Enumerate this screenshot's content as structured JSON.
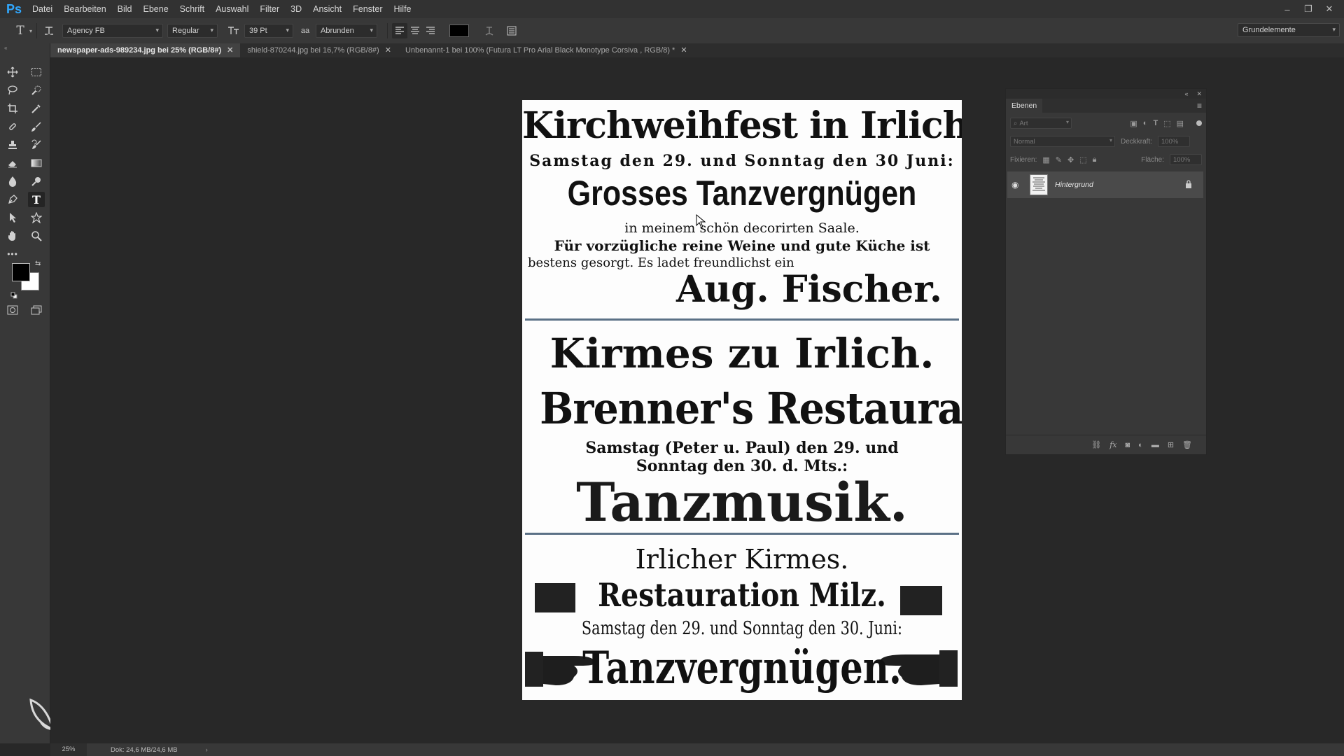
{
  "app": {
    "logo": "Ps"
  },
  "menu": [
    "Datei",
    "Bearbeiten",
    "Bild",
    "Ebene",
    "Schrift",
    "Auswahl",
    "Filter",
    "3D",
    "Ansicht",
    "Fenster",
    "Hilfe"
  ],
  "window_controls": {
    "minimize": "–",
    "restore": "❐",
    "close": "✕"
  },
  "options": {
    "tool_glyph": "T",
    "font_family": "Agency FB",
    "font_style": "Regular",
    "font_size": "39 Pt",
    "antialias_glyph": "aa",
    "antialias": "Abrunden",
    "text_color": "#000000",
    "workspace": "Grundelemente"
  },
  "tabs": [
    {
      "label": "newspaper-ads-989234.jpg bei 25% (RGB/8#)",
      "active": true
    },
    {
      "label": "shield-870244.jpg bei 16,7% (RGB/8#)",
      "active": false
    },
    {
      "label": "Unbenannt-1 bei 100% (Futura LT Pro  Arial Black  Monotype Corsiva  , RGB/8) *",
      "active": false
    }
  ],
  "document": {
    "ad1": {
      "title": "Kirchweihfest in Irlich.",
      "dates": "Samstag den 29. und Sonntag den 30 Juni:",
      "headline": "Grosses Tanzvergnügen",
      "line1": "in meinem schön decorirten Saale.",
      "line2": "Für vorzügliche reine Weine und gute Küche ist",
      "line3": "bestens gesorgt.  Es ladet freundlichst ein",
      "signature": "Aug. Fischer."
    },
    "ad2": {
      "title": "Kirmes zu Irlich.",
      "venue": "Brenner's Restaurant.",
      "line1": "Samstag (Peter u. Paul) den 29. und",
      "line2": "Sonntag den 30. d. Mts.:",
      "headline": "Tanzmusik."
    },
    "ad3": {
      "title": "Irlicher Kirmes.",
      "venue": "Restauration Milz.",
      "dates": "Samstag den 29. und Sonntag den 30. Juni:",
      "headline": "Tanzvergnügen."
    }
  },
  "layers_panel": {
    "tab": "Ebenen",
    "filter": "Art",
    "blend_mode": "Normal",
    "opacity_label": "Deckkraft:",
    "opacity_value": "100%",
    "lock_label": "Fixieren:",
    "fill_label": "Fläche:",
    "fill_value": "100%",
    "layers": [
      {
        "name": "Hintergrund",
        "visible": true,
        "locked": true
      }
    ]
  },
  "status": {
    "zoom": "25%",
    "doc_size": "Dok: 24,6 MB/24,6 MB"
  }
}
